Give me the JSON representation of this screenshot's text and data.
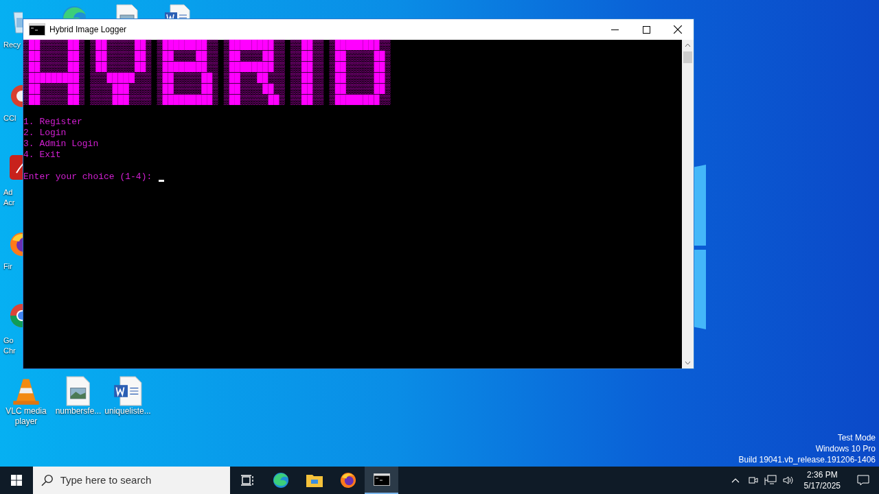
{
  "desktop": {
    "left_icons": [
      {
        "kind": "recycle",
        "lines": [
          "Recy"
        ]
      },
      {
        "kind": "ccleaner",
        "lines": [
          "CCl"
        ]
      },
      {
        "kind": "acrobat",
        "lines": [
          "Ad",
          "Acr"
        ]
      },
      {
        "kind": "firefox",
        "lines": [
          "Fir"
        ]
      },
      {
        "kind": "chrome",
        "lines": [
          "Go",
          "Chr"
        ]
      }
    ],
    "top_icons": [
      {
        "kind": "edge"
      },
      {
        "kind": "image"
      },
      {
        "kind": "word"
      }
    ],
    "bottom_icons": [
      {
        "kind": "vlc",
        "lines": [
          "VLC media",
          "player"
        ]
      },
      {
        "kind": "image",
        "lines": [
          "numbersfe..."
        ]
      },
      {
        "kind": "word",
        "lines": [
          "uniqueliste..."
        ]
      }
    ],
    "system_text": [
      "Test Mode",
      "Windows 10 Pro",
      "Build 19041.vb_release.191206-1406"
    ]
  },
  "window": {
    "title": "Hybrid Image Logger",
    "banner": [
      "▒██▒▒▒▒▒██▒ ▒██▒▒▒▒▒██▒ ▒████████▒▒ ▒████████▒▒ ▒▒██▒▒ ▒████████▒▒",
      "▒██▒▒▒▒▒██▒ ▒██▒▒▒▒▒██▒ ▒██▒▒▒▒██▒▒ ▒██▒▒▒▒██▒▒ ▒▒██▒▒ ▒██▒▒▒▒▒██▒",
      "▒██▒▒▒▒▒██▒ ▒██▒▒▒▒▒██▒ ▒████████▒▒ ▒████████▒▒ ▒▒██▒▒ ▒██▒▒▒▒▒██▒",
      "▒█████████▒ ▒▒▒█████▒▒▒ ▒██▒▒▒▒▒██▒ ▒██▒▒▒██▒▒▒ ▒▒██▒▒ ▒██▒▒▒▒▒██▒",
      "▒██▒▒▒▒▒██▒ ▒▒▒▒███▒▒▒▒ ▒██▒▒▒▒▒██▒ ▒██▒▒▒▒██▒▒ ▒▒██▒▒ ▒██▒▒▒▒▒██▒",
      "▒██▒▒▒▒▒██▒ ▒▒▒▒███▒▒▒▒ ▒█████████▒ ▒██▒▒▒▒▒██▒ ▒▒██▒▒ ▒████████▒▒"
    ],
    "menu": [
      "1. Register",
      "2. Login",
      "3. Admin Login",
      "4. Exit"
    ],
    "prompt": "Enter your choice (1-4): "
  },
  "taskbar": {
    "search_placeholder": "Type here to search",
    "apps": [
      {
        "kind": "taskview",
        "selected": false
      },
      {
        "kind": "edge",
        "selected": false
      },
      {
        "kind": "explorer",
        "selected": false
      },
      {
        "kind": "firefox",
        "selected": false
      },
      {
        "kind": "cmd",
        "selected": true
      }
    ],
    "time": "2:36 PM",
    "date": "5/17/2025"
  }
}
